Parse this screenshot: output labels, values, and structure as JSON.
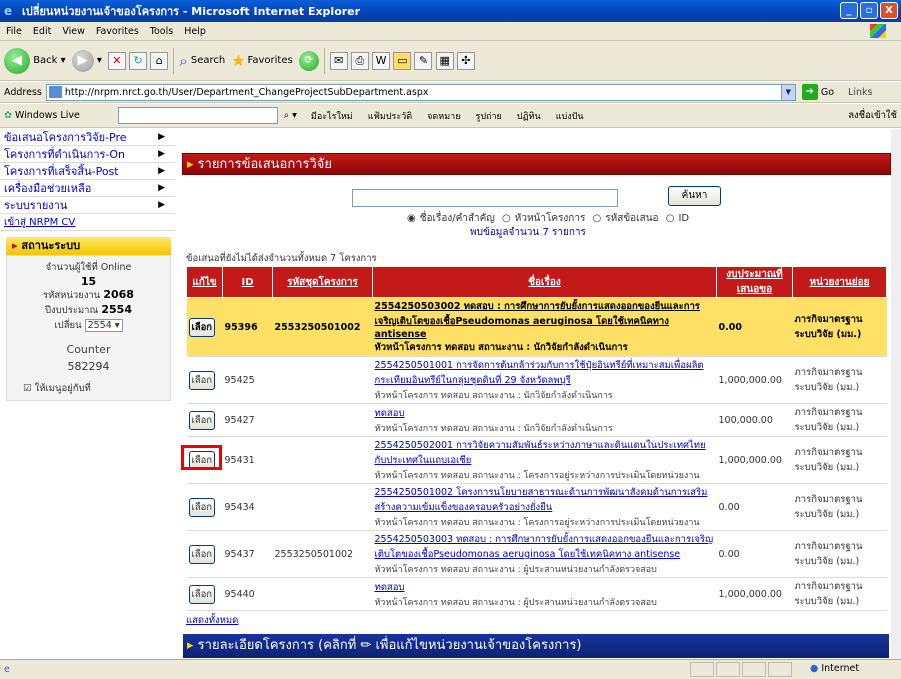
{
  "window": {
    "title": "เปลี่ยนหน่วยงานเจ้าของโครงการ - Microsoft Internet Explorer",
    "min": "_",
    "max": "▫",
    "close": "X"
  },
  "menu": [
    "File",
    "Edit",
    "View",
    "Favorites",
    "Tools",
    "Help"
  ],
  "toolbar": {
    "back": "Back",
    "search": "Search",
    "favorites": "Favorites"
  },
  "address": {
    "label": "Address",
    "url": "http://nrpm.nrct.go.th/User/Department_ChangeProjectSubDepartment.aspx",
    "go": "Go",
    "links": "Links"
  },
  "windows_live": {
    "label": "Windows Live",
    "links": [
      "มีอะไรใหม่",
      "แฟ้มประวัติ",
      "จดหมาย",
      "รูปถ่าย",
      "ปฏิทิน",
      "แบ่งปัน"
    ],
    "signin": "ลงชื่อเข้าใช้"
  },
  "sidebar": {
    "items": [
      "ข้อเสนอโครงการวิจัย-Pre",
      "โครงการที่ดำเนินการ-On",
      "โครงการที่เสร็จสิ้น-Post",
      "เครื่องมือช่วยเหลือ",
      "ระบบรายงาน"
    ],
    "link": "เข้าสู่ NRPM CV"
  },
  "status": {
    "title": "สถานะระบบ",
    "online_label": "จำนวนผู้ใช้ที่ Online",
    "online": "15",
    "unit_label": "รหัสหน่วยงาน",
    "unit": "2068",
    "fy_label": "ปีงบประมาณ",
    "fy": "2554",
    "change": "เปลี่ยน",
    "year": "2554",
    "counter_label": "Counter",
    "counter": "582294",
    "menu_check": "ให้เมนูอยู่กับที่"
  },
  "panel": {
    "title": "รายการข้อเสนอการวิจัย",
    "search_btn": "ค้นหา",
    "radios": [
      "ชื่อเรื่อง/คำสำคัญ",
      "หัวหน้าโครงการ",
      "รหัสข้อเสนอ",
      "ID"
    ],
    "found": "พบข้อมูลจำนวน 7 รายการ",
    "count_text": "ข้อเสนอที่ยังไม่ได้ส่งจำนวนทั้งหมด 7 โครงการ"
  },
  "table": {
    "headers": [
      "แก้ไข",
      "ID",
      "รหัสชุดโครงการ",
      "ชื่อเรื่อง",
      "งบประมาณที่เสนอขอ",
      "หน่วยงานย่อย"
    ],
    "select": "เลือก",
    "rows": [
      {
        "id": "95396",
        "set": "2553250501002",
        "title": "2554250503002 ทดสอบ : การศึกษาการยับยั้งการแสดงออกของยีนและการเจริญเติบโตของเชื้อPseudomonas aeruginosa โดยใช้เทคนิคทาง antisense",
        "sub": "หัวหน้าโครงการ ทดสอบ สถานะงาน : นักวิจัยกำลังดำเนินการ",
        "budget": "0.00",
        "dept": "ภารกิจมาตรฐานระบบวิจัย (มม.)",
        "hl": true
      },
      {
        "id": "95425",
        "set": "",
        "title": "2554250501001 การจัดการต้นกล้าร่วมกับการใช้ปุ๋ยอินทรีย์ที่เหมาะสมเพื่อผลิตกระเทียมอินทรีย์ในกลุ่มชุดดินที่ 29 จังหวัดลพบุรี",
        "sub": "หัวหน้าโครงการ ทดสอบ สถานะงาน : นักวิจัยกำลังดำเนินการ",
        "budget": "1,000,000.00",
        "dept": "ภารกิจมาตรฐานระบบวิจัย (มม.)"
      },
      {
        "id": "95427",
        "set": "",
        "title": "ทดสอบ",
        "sub": "หัวหน้าโครงการ ทดสอบ สถานะงาน : นักวิจัยกำลังดำเนินการ",
        "budget": "100,000.00",
        "dept": "ภารกิจมาตรฐานระบบวิจัย (มม.)"
      },
      {
        "id": "95431",
        "set": "",
        "title": "2554250502001 การวิจัยความสัมพันธ์ระหว่างภาษาและดินแดนในประเทศไทยกับประเทศในแถบเอเชีย",
        "sub": "หัวหน้าโครงการ ทดสอบ สถานะงาน : โครงการอยู่ระหว่างการประเมินโดยหน่วยงาน",
        "budget": "1,000,000.00",
        "dept": "ภารกิจมาตรฐานระบบวิจัย (มม.)"
      },
      {
        "id": "95434",
        "set": "",
        "title": "2554250501002 โครงการนโยบายสาธารณะด้านการพัฒนาสังคมด้านการเสริมสร้างความเข้มแข็งของครอบครัวอย่างยั่งยืน",
        "sub": "หัวหน้าโครงการ ทดสอบ สถานะงาน : โครงการอยู่ระหว่างการประเมินโดยหน่วยงาน",
        "budget": "0.00",
        "dept": "ภารกิจมาตรฐานระบบวิจัย (มม.)"
      },
      {
        "id": "95437",
        "set": "2553250501002",
        "title": "2554250503003 ทดสอบ : การศึกษาการยับยั้งการแสดงออกของยีนและการเจริญเติบโตของเชื้อPseudomonas aeruginosa โดยใช้เทคนิคทาง antisense",
        "sub": "หัวหน้าโครงการ ทดสอบ สถานะงาน : ผู้ประสานหน่วยงานกำลังตรวจสอบ",
        "budget": "0.00",
        "dept": "ภารกิจมาตรฐานระบบวิจัย (มม.)"
      },
      {
        "id": "95440",
        "set": "",
        "title": "ทดสอบ",
        "sub": "หัวหน้าโครงการ ทดสอบ สถานะงาน : ผู้ประสานหน่วยงานกำลังตรวจสอบ",
        "budget": "1,000,000.00",
        "dept": "ภารกิจมาตรฐานระบบวิจัย (มม.)"
      }
    ],
    "show_all": "แสดงทั้งหมด"
  },
  "detail_title": "รายละเอียดโครงการ (คลิกที่ ✏ เพื่อแก้ไขหน่วยงานเจ้าของโครงการ)",
  "statusbar": {
    "zone": "Internet"
  }
}
